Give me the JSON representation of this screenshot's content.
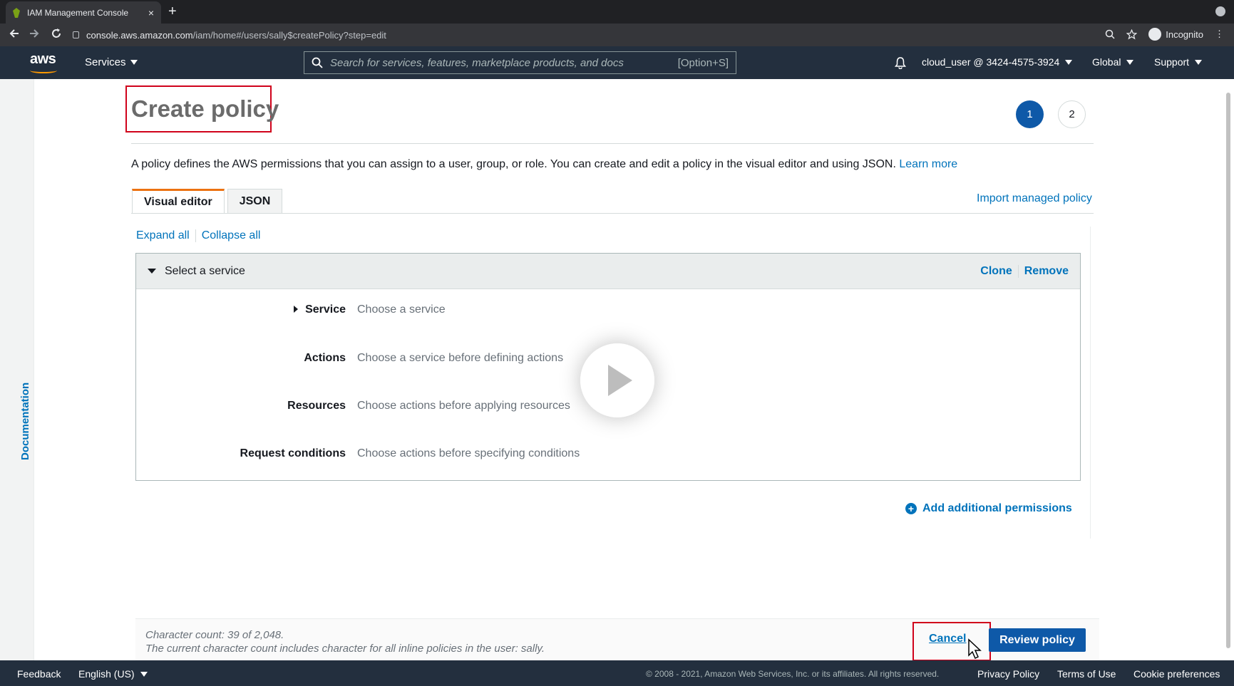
{
  "browser": {
    "tab_title": "IAM Management Console",
    "tab_close": "×",
    "new_tab": "+",
    "url_host": "console.aws.amazon.com",
    "url_path": "/iam/home#/users/sally$createPolicy?step=edit",
    "profile_label": "Incognito"
  },
  "aws_nav": {
    "logo_text": "aws",
    "services_label": "Services",
    "search_placeholder": "Search for services, features, marketplace products, and docs",
    "search_shortcut": "[Option+S]",
    "account_label": "cloud_user @ 3424-4575-3924",
    "region_label": "Global",
    "support_label": "Support"
  },
  "sidebar": {
    "documentation_label": "Documentation"
  },
  "page": {
    "title": "Create policy",
    "steps": [
      "1",
      "2"
    ],
    "active_step": 1,
    "intro_text": "A policy defines the AWS permissions that you can assign to a user, group, or role. You can create and edit a policy in the visual editor and using JSON.",
    "learn_more": "Learn more",
    "tabs": [
      {
        "label": "Visual editor",
        "active": true
      },
      {
        "label": "JSON",
        "active": false
      }
    ],
    "import_link": "Import managed policy",
    "expand_all": "Expand all",
    "collapse_all": "Collapse all",
    "panel": {
      "title": "Select a service",
      "clone": "Clone",
      "remove": "Remove",
      "rows": [
        {
          "label": "Service",
          "value": "Choose a service",
          "is_link": true
        },
        {
          "label": "Actions",
          "value": "Choose a service before defining actions"
        },
        {
          "label": "Resources",
          "value": "Choose actions before applying resources"
        },
        {
          "label": "Request conditions",
          "value": "Choose actions before specifying conditions"
        }
      ]
    },
    "add_permissions": "Add additional permissions",
    "char_count_line1": "Character count: 39 of 2,048.",
    "char_count_line2": "The current character count includes character for all inline policies in the user: sally.",
    "cancel_label": "Cancel",
    "review_label": "Review policy"
  },
  "footer": {
    "feedback": "Feedback",
    "language": "English (US)",
    "copyright": "© 2008 - 2021, Amazon Web Services, Inc. or its affiliates. All rights reserved.",
    "privacy": "Privacy Policy",
    "terms": "Terms of Use",
    "cookies": "Cookie preferences"
  },
  "colors": {
    "aws_nav_bg": "#232f3e",
    "link": "#0073bb",
    "primary_button": "#0e59a8",
    "highlight_box": "#d0021b",
    "tab_accent": "#ec7211"
  }
}
